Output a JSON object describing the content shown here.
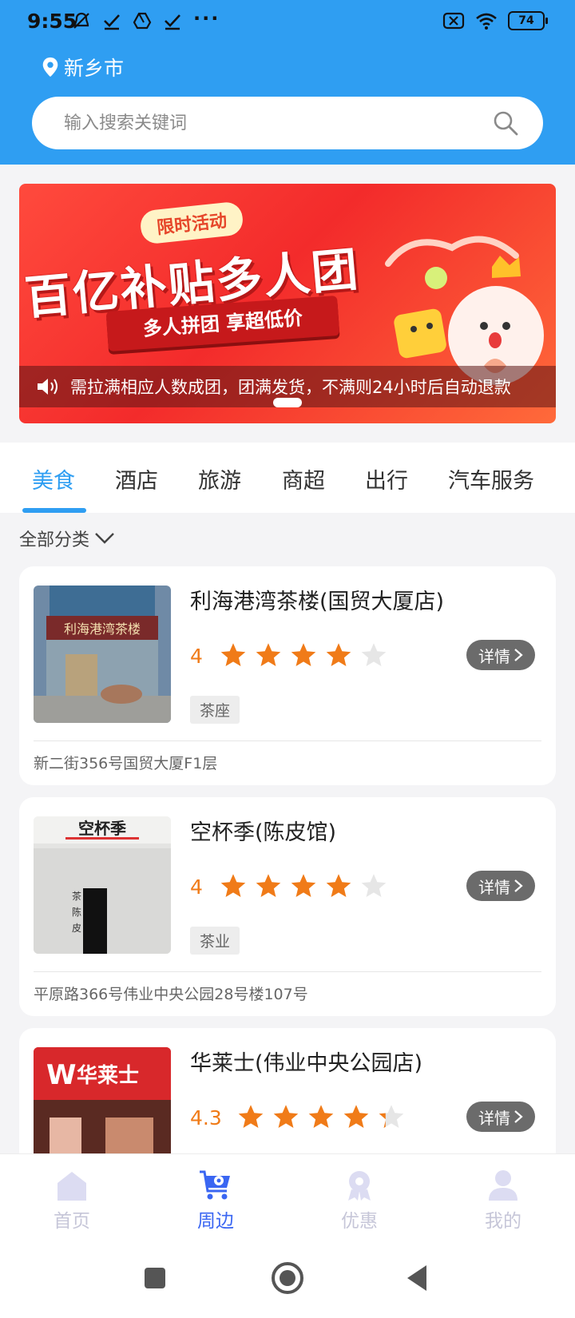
{
  "status_bar": {
    "time": "9:55",
    "more": "···",
    "battery": "74"
  },
  "header": {
    "city": "新乡市",
    "search_placeholder": "输入搜索关键词",
    "background_color": "#2f9ef2"
  },
  "banner": {
    "tag": "限时活动",
    "title": "百亿补贴多人团",
    "subtitle": "多人拼团 享超低价",
    "notice": "需拉满相应人数成团，团满发货，不满则24小时后自动退款"
  },
  "tabs": [
    {
      "label": "美食",
      "active": true
    },
    {
      "label": "酒店",
      "active": false
    },
    {
      "label": "旅游",
      "active": false
    },
    {
      "label": "商超",
      "active": false
    },
    {
      "label": "出行",
      "active": false
    },
    {
      "label": "汽车服务",
      "active": false
    }
  ],
  "filter": {
    "label": "全部分类"
  },
  "listings": [
    {
      "name": "利海港湾茶楼(国贸大厦店)",
      "rating": "4",
      "rating_value": 4,
      "tag": "茶座",
      "address": "新二街356号国贸大厦F1层",
      "details_label": "详情",
      "sign_text": "利海港湾茶楼"
    },
    {
      "name": "空杯季(陈皮馆)",
      "rating": "4",
      "rating_value": 4,
      "tag": "茶业",
      "address": "平原路366号伟业中央公园28号楼107号",
      "details_label": "详情",
      "sign_text": "空杯季"
    },
    {
      "name": "华莱士(伟业中央公园店)",
      "rating": "4.3",
      "rating_value": 4.3,
      "tag": "",
      "address": "",
      "details_label": "详情",
      "sign_text": "华莱士"
    }
  ],
  "bottom_nav": [
    {
      "label": "首页",
      "icon": "home-icon",
      "active": false
    },
    {
      "label": "周边",
      "icon": "cart-location-icon",
      "active": true
    },
    {
      "label": "优惠",
      "icon": "badge-icon",
      "active": false
    },
    {
      "label": "我的",
      "icon": "user-icon",
      "active": false
    }
  ],
  "colors": {
    "accent": "#2f9ef2",
    "nav_active": "#3a66f2",
    "star_filled": "#f07b18",
    "star_empty": "#e6e6e6"
  }
}
